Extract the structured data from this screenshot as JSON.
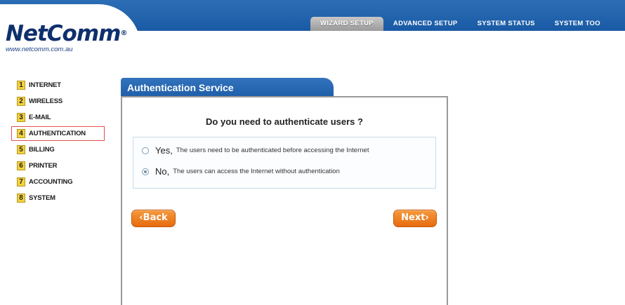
{
  "nav": {
    "tabs": [
      "WIZARD SETUP",
      "ADVANCED SETUP",
      "SYSTEM STATUS",
      "SYSTEM TOO"
    ],
    "active": "WIZARD SETUP"
  },
  "logo": {
    "brand": "NetComm",
    "reg": "®",
    "url": "www.netcomm.com.au"
  },
  "sidebar": {
    "steps": [
      {
        "num": "1",
        "label": "INTERNET"
      },
      {
        "num": "2",
        "label": "WIRELESS"
      },
      {
        "num": "3",
        "label": "E-MAIL"
      },
      {
        "num": "4",
        "label": "AUTHENTICATION"
      },
      {
        "num": "5",
        "label": "BILLING"
      },
      {
        "num": "6",
        "label": "PRINTER"
      },
      {
        "num": "7",
        "label": "ACCOUNTING"
      },
      {
        "num": "8",
        "label": "SYSTEM"
      }
    ],
    "selected": "AUTHENTICATION"
  },
  "panel": {
    "title": "Authentication Service",
    "question": "Do you need to authenticate users ?",
    "options": [
      {
        "key": "Yes,",
        "desc": "The users need to be authenticated before accessing the Internet",
        "checked": false
      },
      {
        "key": "No,",
        "desc": "The users can access the Internet without authentication",
        "checked": true
      }
    ],
    "back_label": "‹Back",
    "next_label": "Next›"
  },
  "colors": {
    "header_blue": "#1a5aa5",
    "step_badge": "#f3d23d",
    "button_orange": "#e66a10",
    "selection_border": "#e05050"
  }
}
